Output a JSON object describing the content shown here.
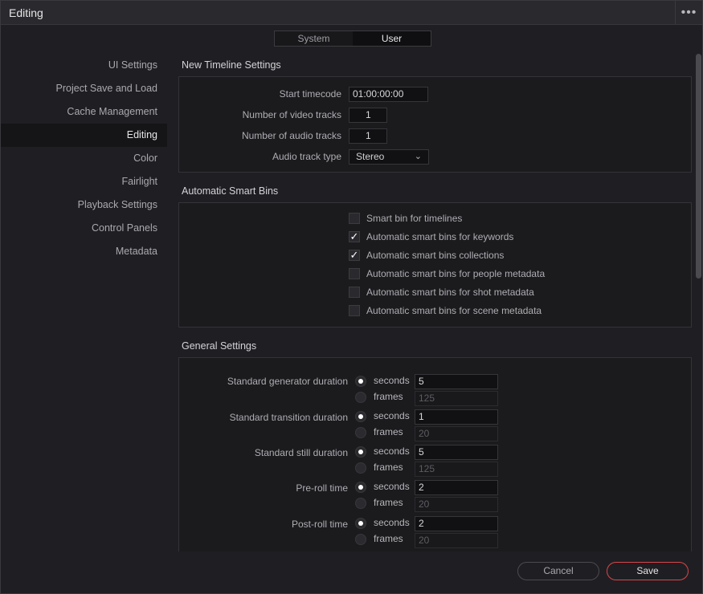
{
  "window": {
    "title": "Editing",
    "more_label": "•••"
  },
  "segment": {
    "options": [
      "System",
      "User"
    ],
    "selected": "User"
  },
  "sidebar": {
    "items": [
      {
        "label": "UI Settings"
      },
      {
        "label": "Project Save and Load"
      },
      {
        "label": "Cache Management"
      },
      {
        "label": "Editing",
        "active": true
      },
      {
        "label": "Color"
      },
      {
        "label": "Fairlight"
      },
      {
        "label": "Playback Settings"
      },
      {
        "label": "Control Panels"
      },
      {
        "label": "Metadata"
      }
    ]
  },
  "timeline": {
    "title": "New Timeline Settings",
    "start_timecode_label": "Start timecode",
    "start_timecode": "01:00:00:00",
    "video_tracks_label": "Number of video tracks",
    "video_tracks": "1",
    "audio_tracks_label": "Number of audio tracks",
    "audio_tracks": "1",
    "audio_type_label": "Audio track type",
    "audio_type": "Stereo",
    "chevron": "⌄"
  },
  "smart_bins": {
    "title": "Automatic Smart Bins",
    "items": [
      {
        "label": "Smart bin for timelines",
        "checked": false,
        "mark": ""
      },
      {
        "label": "Automatic smart bins for keywords",
        "checked": true,
        "mark": "✓"
      },
      {
        "label": "Automatic smart bins collections",
        "checked": true,
        "mark": "✓"
      },
      {
        "label": "Automatic smart bins for people metadata",
        "checked": false,
        "mark": ""
      },
      {
        "label": "Automatic smart bins for shot metadata",
        "checked": false,
        "mark": ""
      },
      {
        "label": "Automatic smart bins for scene metadata",
        "checked": false,
        "mark": ""
      }
    ]
  },
  "general": {
    "title": "General Settings",
    "seconds_label": "seconds",
    "frames_label": "frames",
    "rows": [
      {
        "label": "Standard generator duration",
        "seconds": "5",
        "frames": "125"
      },
      {
        "label": "Standard transition duration",
        "seconds": "1",
        "frames": "20"
      },
      {
        "label": "Standard still duration",
        "seconds": "5",
        "frames": "125"
      },
      {
        "label": "Pre-roll time",
        "seconds": "2",
        "frames": "20"
      },
      {
        "label": "Post-roll time",
        "seconds": "2",
        "frames": "20"
      }
    ]
  },
  "footer": {
    "cancel": "Cancel",
    "save": "Save"
  },
  "colors": {
    "save_border": "#d9454a",
    "active_bg": "#151518"
  }
}
